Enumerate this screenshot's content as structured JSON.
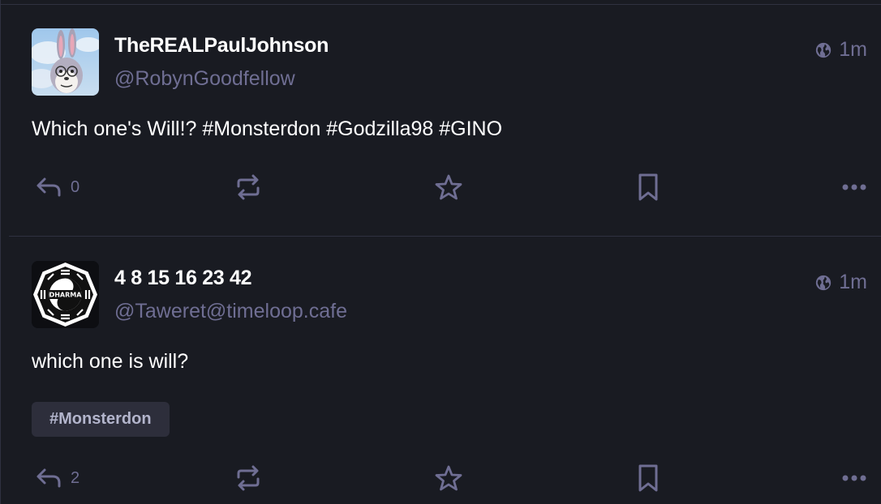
{
  "colors": {
    "background": "#191b22",
    "divider": "#2f3140",
    "text": "#ffffff",
    "muted": "#6f6e93",
    "chip_bg": "#2d2e3b"
  },
  "statuses": [
    {
      "display_name": "TheREALPaulJohnson",
      "handle": "@RobynGoodfellow",
      "visibility_icon": "globe-icon",
      "time": "1m",
      "content": "Which one's Will!? #Monsterdon #Godzilla98 #GINO",
      "avatar_icon": "bunny-avatar",
      "actions": {
        "reply_count": "0",
        "reply_icon": "reply-icon",
        "boost_icon": "boost-icon",
        "favourite_icon": "star-icon",
        "bookmark_icon": "bookmark-icon",
        "more_icon": "more-icon"
      }
    },
    {
      "display_name": "4 8 15 16 23 42",
      "handle": "@Taweret@timeloop.cafe",
      "visibility_icon": "globe-icon",
      "time": "1m",
      "content": "which one is will?",
      "hashtag": "#Monsterdon",
      "avatar_icon": "dharma-logo-avatar",
      "avatar_logo_text": "DHARMA",
      "actions": {
        "reply_count": "2",
        "reply_icon": "reply-icon",
        "boost_icon": "boost-icon",
        "favourite_icon": "star-icon",
        "bookmark_icon": "bookmark-icon",
        "more_icon": "more-icon"
      }
    }
  ]
}
